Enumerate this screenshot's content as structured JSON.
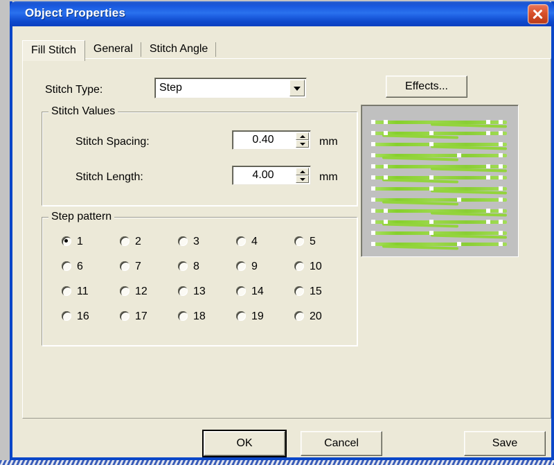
{
  "window": {
    "title": "Object Properties",
    "close_icon": "close-icon",
    "titlebar_color": "#1d55d0",
    "face_color": "#ECE9D8",
    "border_color": "#0A46C8"
  },
  "tabs": [
    {
      "label": "Fill Stitch",
      "active": true
    },
    {
      "label": "General",
      "active": false
    },
    {
      "label": "Stitch Angle",
      "active": false
    }
  ],
  "fill_stitch": {
    "stitch_type": {
      "label": "Stitch Type:",
      "value": "Step",
      "options": [
        "Step"
      ],
      "arrow_icon": "chevron-down-icon"
    },
    "effects_button": "Effects...",
    "stitch_values": {
      "title": "Stitch Values",
      "fields": [
        {
          "label": "Stitch Spacing:",
          "value": "0.40",
          "unit": "mm"
        },
        {
          "label": "Stitch Length:",
          "value": "4.00",
          "unit": "mm"
        }
      ]
    },
    "step_pattern": {
      "title": "Step pattern",
      "selected": "1",
      "options": [
        "1",
        "2",
        "3",
        "4",
        "5",
        "6",
        "7",
        "8",
        "9",
        "10",
        "11",
        "12",
        "13",
        "14",
        "15",
        "16",
        "17",
        "18",
        "19",
        "20"
      ]
    },
    "preview": {
      "name": "stitch-preview",
      "background": "#C0C0C0",
      "stitch_color": "#8ED239",
      "node_color": "#FFFFFF",
      "rows": 12
    }
  },
  "footer": {
    "ok": "OK",
    "cancel": "Cancel",
    "save": "Save"
  }
}
